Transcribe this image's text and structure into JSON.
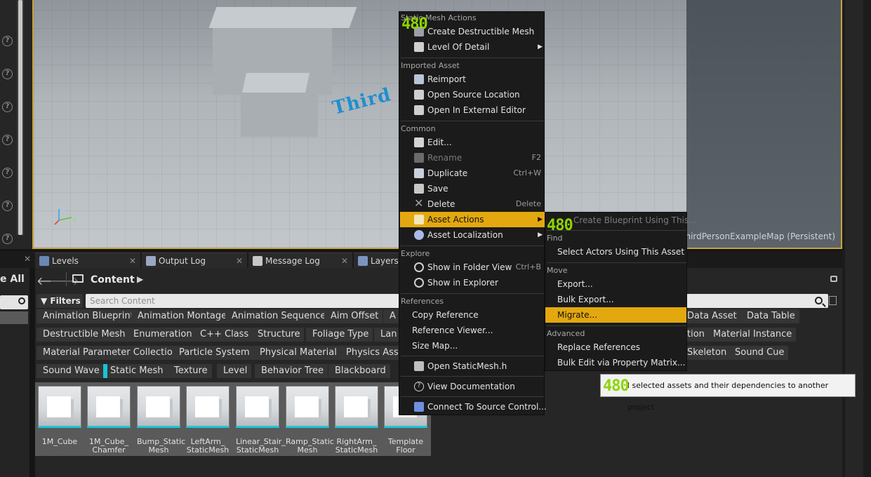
{
  "viewport": {
    "map_name": "ThirdPersonExampleMap (Persistent)",
    "floor_text": "Third",
    "axis": {
      "z": "Z",
      "y": "Y"
    }
  },
  "tabs": [
    {
      "label": "Levels"
    },
    {
      "label": "Output Log"
    },
    {
      "label": "Message Log"
    },
    {
      "label": "Layers"
    }
  ],
  "content_browser": {
    "save_all": "e All",
    "path": "Content",
    "filters_label": "Filters",
    "search_placeholder": "Search Content",
    "filter_chips": [
      "Animation Blueprint",
      "Animation Montage",
      "Animation Sequence",
      "Aim Offset",
      "A",
      "Data Asset",
      "Data Table",
      "Destructible Mesh",
      "Enumeration",
      "C++ Class",
      "Structure",
      "Foliage Type",
      "Lan",
      "tion",
      "Material Instance",
      "Material Parameter Collection",
      "Particle System",
      "Physical Material",
      "Physics Ass",
      "Skeleton",
      "Sound Cue",
      "Sound Wave",
      "Static Mesh",
      "Texture",
      "Level",
      "Behavior Tree",
      "Blackboard"
    ],
    "assets": [
      {
        "name": "1M_Cube"
      },
      {
        "name": "1M_Cube_ Chamfer"
      },
      {
        "name": "Bump_Static Mesh"
      },
      {
        "name": "LeftArm_ StaticMesh"
      },
      {
        "name": "Linear_Stair_ StaticMesh"
      },
      {
        "name": "Ramp_Static Mesh"
      },
      {
        "name": "RightArm_ StaticMesh"
      },
      {
        "name": "Template Floor"
      }
    ]
  },
  "context_menu": {
    "overlay_number": "480",
    "sections": {
      "static_mesh_actions": "Static Mesh Actions",
      "imported_asset": "Imported Asset",
      "common": "Common",
      "explore": "Explore",
      "references": "References"
    },
    "items": {
      "create_destructible_mesh": "Create Destructible Mesh",
      "level_of_detail": "Level Of Detail",
      "reimport": "Reimport",
      "open_source_location": "Open Source Location",
      "open_in_external_editor": "Open In External Editor",
      "edit": "Edit...",
      "rename": "Rename",
      "rename_shortcut": "F2",
      "duplicate": "Duplicate",
      "duplicate_shortcut": "Ctrl+W",
      "save": "Save",
      "delete": "Delete",
      "delete_shortcut": "Delete",
      "asset_actions": "Asset Actions",
      "asset_localization": "Asset Localization",
      "show_in_folder_view": "Show in Folder View",
      "show_in_folder_view_shortcut": "Ctrl+B",
      "show_in_explorer": "Show in Explorer",
      "copy_reference": "Copy Reference",
      "reference_viewer": "Reference Viewer...",
      "size_map": "Size Map...",
      "open_static_mesh_h": "Open StaticMesh.h",
      "view_documentation": "View Documentation",
      "connect_to_source_control": "Connect To Source Control..."
    }
  },
  "submenu": {
    "overlay_number": "480",
    "items": {
      "create_blueprint": "Create Blueprint Using This...",
      "find_section": "Find",
      "select_actors": "Select Actors Using This Asset",
      "move_section": "Move",
      "export": "Export...",
      "bulk_export": "Bulk Export...",
      "migrate": "Migrate...",
      "advanced_section": "Advanced",
      "replace_references": "Replace References",
      "bulk_edit": "Bulk Edit via Property Matrix..."
    }
  },
  "tooltip": {
    "overlay_number": "480",
    "text": "l selected assets and their dependencies to another project"
  },
  "colors": {
    "highlight": "#e3a80f",
    "accent_cyan": "#19c2d6",
    "viewport_border": "#c9a23a"
  }
}
